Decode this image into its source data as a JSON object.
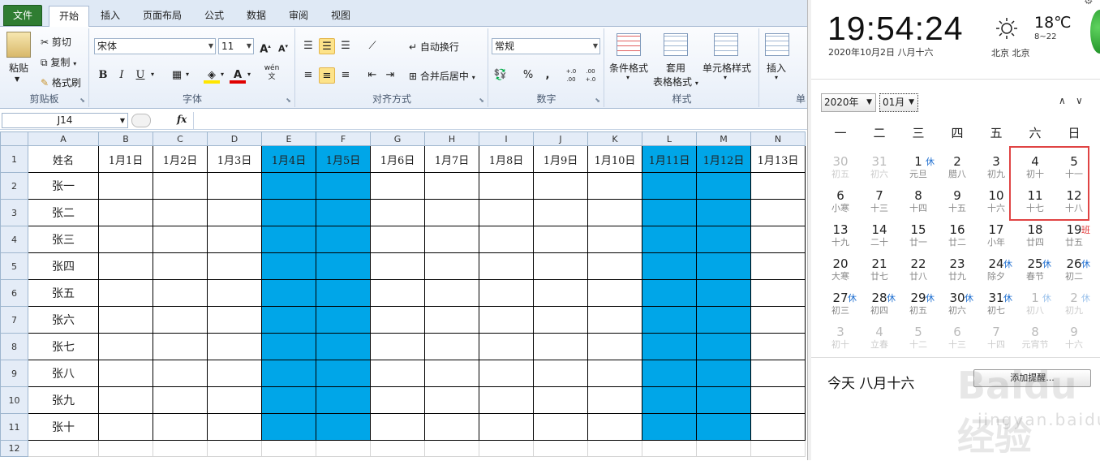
{
  "ribbon_tabs": [
    "文件",
    "开始",
    "插入",
    "页面布局",
    "公式",
    "数据",
    "审阅",
    "视图"
  ],
  "clipboard": {
    "paste": "粘贴",
    "cut": "剪切",
    "copy": "复制",
    "format_painter": "格式刷",
    "label": "剪贴板"
  },
  "font": {
    "name": "宋体",
    "size": "11",
    "label": "字体",
    "bold": "B",
    "italic": "I",
    "underline": "U",
    "phonetic": "wén"
  },
  "align": {
    "wrap": "自动换行",
    "merge": "合并后居中",
    "label": "对齐方式"
  },
  "number": {
    "format": "常规",
    "percent": "%",
    "comma": ",",
    "inc_dec": "+.0 .00",
    "dec_dec": ".00 +.0",
    "label": "数字"
  },
  "styles": {
    "cond": "条件格式",
    "table1": "套用",
    "table2": "表格格式",
    "cell": "单元格样式",
    "label": "样式"
  },
  "cells": {
    "insert": "插入",
    "label": "单"
  },
  "formula_bar": {
    "name_box": "J14",
    "fx": "fx",
    "value": ""
  },
  "sheet": {
    "columns": [
      "A",
      "B",
      "C",
      "D",
      "E",
      "F",
      "G",
      "H",
      "I",
      "J",
      "K",
      "L",
      "M",
      "N"
    ],
    "header_row": [
      "姓名",
      "1月1日",
      "1月2日",
      "1月3日",
      "1月4日",
      "1月5日",
      "1月6日",
      "1月7日",
      "1月8日",
      "1月9日",
      "1月10日",
      "1月11日",
      "1月12日",
      "1月13日"
    ],
    "names": [
      "张一",
      "张二",
      "张三",
      "张四",
      "张五",
      "张六",
      "张七",
      "张八",
      "张九",
      "张十"
    ],
    "row_numbers": [
      "1",
      "2",
      "3",
      "4",
      "5",
      "6",
      "7",
      "8",
      "9",
      "10",
      "11",
      "12"
    ],
    "highlight_color": "#00a6e8",
    "highlight_columns": [
      "E",
      "F",
      "L",
      "M"
    ]
  },
  "calendar": {
    "time": "19:54:24",
    "date_line": "2020年10月2日 八月十六",
    "temp": "18℃",
    "temp_range": "8~22",
    "city": "北京 北京",
    "year_select": "2020年",
    "month_select": "01月",
    "weekdays": [
      "一",
      "二",
      "三",
      "四",
      "五",
      "六",
      "日"
    ],
    "weeks": [
      [
        {
          "n": "30",
          "l": "初五",
          "dim": true
        },
        {
          "n": "31",
          "l": "初六",
          "dim": true
        },
        {
          "n": "1",
          "l": "元旦",
          "b": "休",
          "bt": "rest"
        },
        {
          "n": "2",
          "l": "腊八"
        },
        {
          "n": "3",
          "l": "初九"
        },
        {
          "n": "4",
          "l": "初十"
        },
        {
          "n": "5",
          "l": "十一"
        }
      ],
      [
        {
          "n": "6",
          "l": "小寒"
        },
        {
          "n": "7",
          "l": "十三"
        },
        {
          "n": "8",
          "l": "十四"
        },
        {
          "n": "9",
          "l": "十五"
        },
        {
          "n": "10",
          "l": "十六"
        },
        {
          "n": "11",
          "l": "十七"
        },
        {
          "n": "12",
          "l": "十八"
        }
      ],
      [
        {
          "n": "13",
          "l": "十九"
        },
        {
          "n": "14",
          "l": "二十"
        },
        {
          "n": "15",
          "l": "廿一"
        },
        {
          "n": "16",
          "l": "廿二"
        },
        {
          "n": "17",
          "l": "小年"
        },
        {
          "n": "18",
          "l": "廿四"
        },
        {
          "n": "19",
          "l": "廿五",
          "b": "班",
          "bt": "work"
        }
      ],
      [
        {
          "n": "20",
          "l": "大寒"
        },
        {
          "n": "21",
          "l": "廿七"
        },
        {
          "n": "22",
          "l": "廿八"
        },
        {
          "n": "23",
          "l": "廿九"
        },
        {
          "n": "24",
          "l": "除夕",
          "b": "休",
          "bt": "rest"
        },
        {
          "n": "25",
          "l": "春节",
          "b": "休",
          "bt": "rest"
        },
        {
          "n": "26",
          "l": "初二",
          "b": "休",
          "bt": "rest"
        }
      ],
      [
        {
          "n": "27",
          "l": "初三",
          "b": "休",
          "bt": "rest"
        },
        {
          "n": "28",
          "l": "初四",
          "b": "休",
          "bt": "rest"
        },
        {
          "n": "29",
          "l": "初五",
          "b": "休",
          "bt": "rest"
        },
        {
          "n": "30",
          "l": "初六",
          "b": "休",
          "bt": "rest"
        },
        {
          "n": "31",
          "l": "初七",
          "b": "休",
          "bt": "rest"
        },
        {
          "n": "1",
          "l": "初八",
          "b": "休",
          "bt": "rest",
          "dim": true
        },
        {
          "n": "2",
          "l": "初九",
          "b": "休",
          "bt": "rest",
          "dim": true
        }
      ],
      [
        {
          "n": "3",
          "l": "初十",
          "dim": true
        },
        {
          "n": "4",
          "l": "立春",
          "dim": true
        },
        {
          "n": "5",
          "l": "十二",
          "dim": true
        },
        {
          "n": "6",
          "l": "十三",
          "dim": true
        },
        {
          "n": "7",
          "l": "十四",
          "dim": true
        },
        {
          "n": "8",
          "l": "元宵节",
          "dim": true
        },
        {
          "n": "9",
          "l": "十六",
          "dim": true
        }
      ]
    ],
    "today_text": "今天 八月十六",
    "remind_button": "添加提醒...",
    "watermark": "Baidu经验",
    "watermark_url": "jingyan.baidu.com"
  }
}
